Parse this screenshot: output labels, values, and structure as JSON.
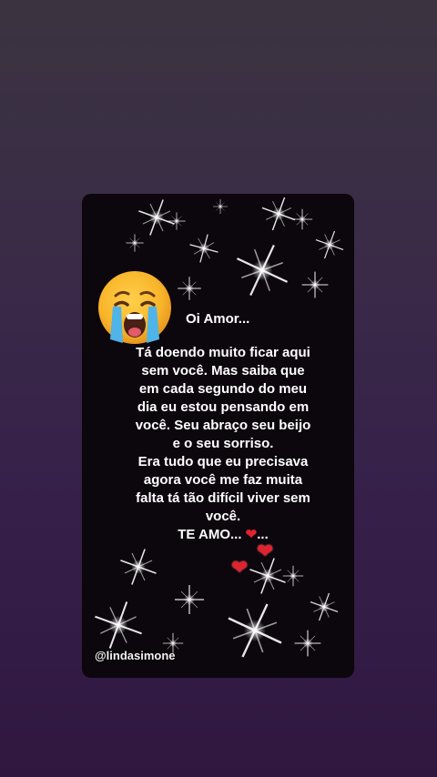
{
  "post": {
    "greeting": "Oi Amor...",
    "message_lines": [
      "Tá doendo muito ficar aqui",
      "sem você. Mas saiba que",
      "em cada segundo do meu",
      "dia eu estou pensando em",
      "você. Seu abraço seu beijo",
      "e o seu sorriso.",
      "Era tudo que eu precisava",
      "agora você me faz muita",
      "falta tá tão difícil viver sem",
      "você."
    ],
    "closing": "TE AMO...",
    "closing_heart": "❤",
    "closing_trail": "...",
    "handle": "@lindasimone"
  },
  "icons": {
    "emoji": "crying-face-icon",
    "heart": "heart-icon",
    "sparkle": "sparkle-icon"
  },
  "colors": {
    "card_background": "#0c060d",
    "page_background_top": "#3b3440",
    "page_background_bottom": "#2f1740",
    "heart": "#e0232e",
    "text": "#ffffff"
  }
}
